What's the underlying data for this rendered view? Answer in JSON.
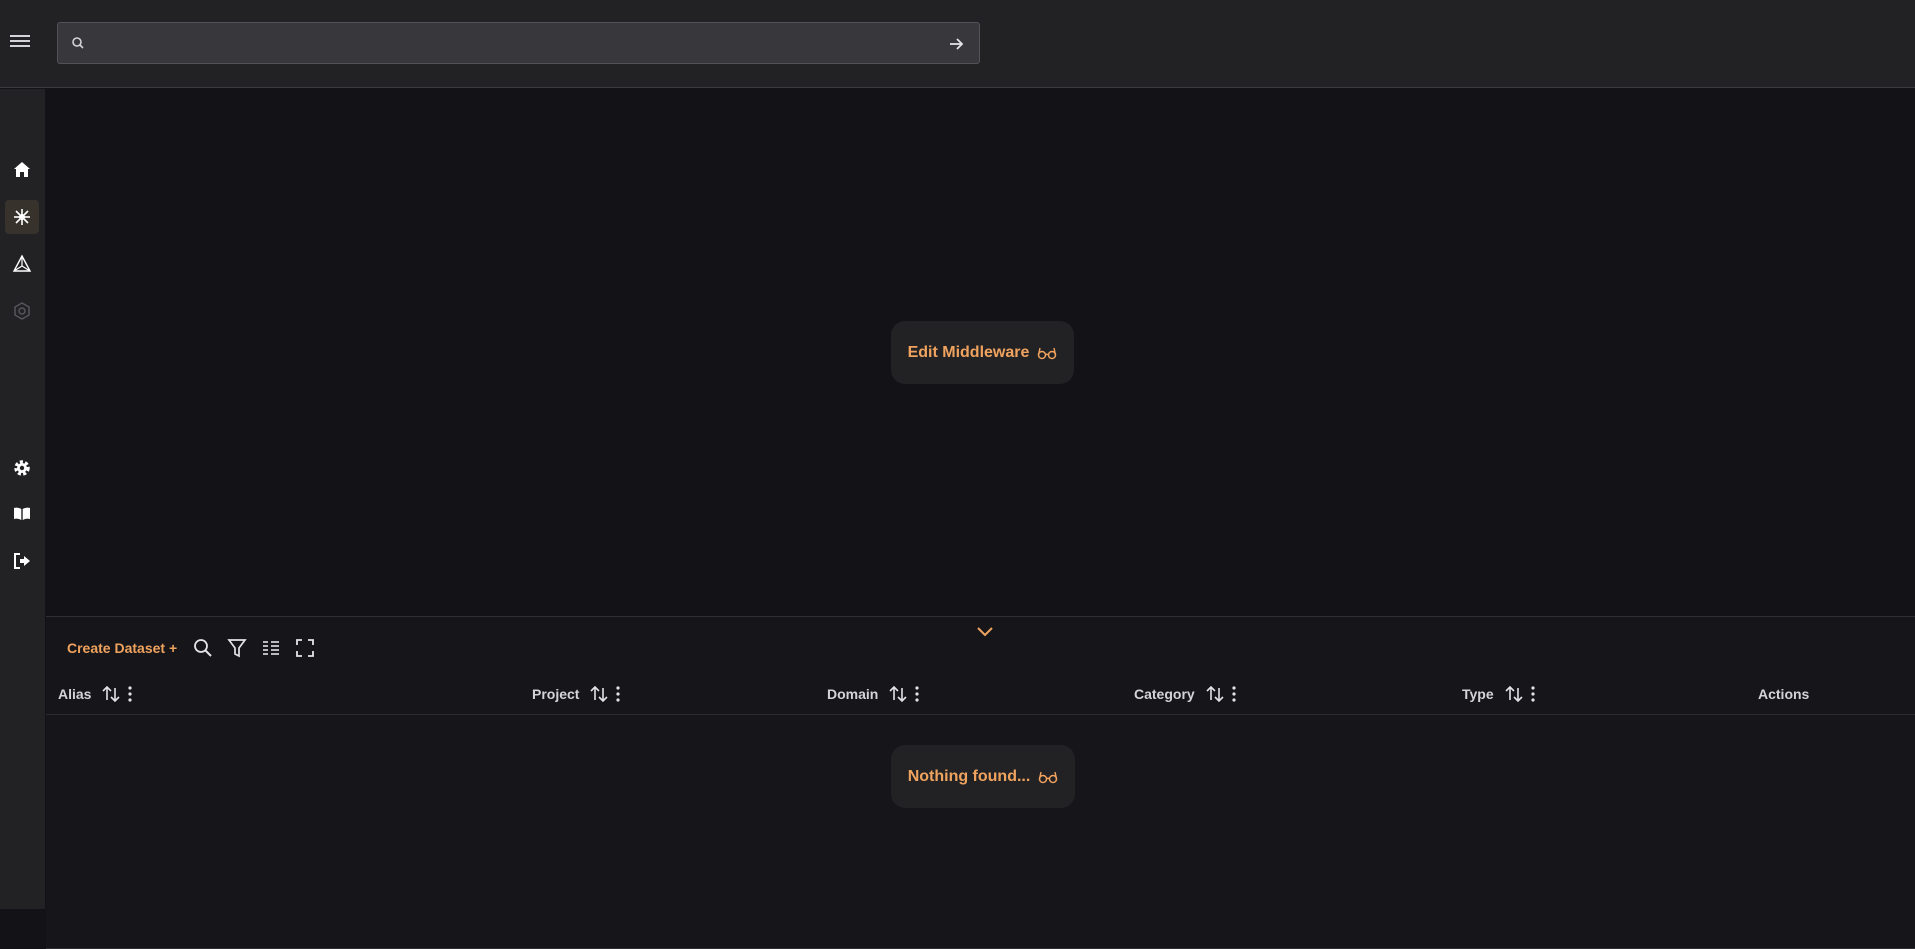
{
  "search": {
    "value": "",
    "placeholder": ""
  },
  "sidebar": {
    "items": [
      {
        "name": "home",
        "icon": "home-icon",
        "active": false
      },
      {
        "name": "middleware",
        "icon": "sparkle-icon",
        "active": true
      },
      {
        "name": "graph",
        "icon": "triangle-network-icon",
        "active": false
      },
      {
        "name": "settings-disabled",
        "icon": "hex-gear-icon",
        "active": false
      },
      {
        "name": "settings",
        "icon": "gear-icon",
        "active": false
      },
      {
        "name": "docs",
        "icon": "book-icon",
        "active": false
      },
      {
        "name": "logout",
        "icon": "logout-icon",
        "active": false
      }
    ]
  },
  "main": {
    "edit_label": "Edit Middleware"
  },
  "panel": {
    "create_label": "Create Dataset +",
    "columns": [
      {
        "label": "Alias"
      },
      {
        "label": "Project"
      },
      {
        "label": "Domain"
      },
      {
        "label": "Category"
      },
      {
        "label": "Type"
      },
      {
        "label": "Actions"
      }
    ],
    "empty_label": "Nothing found..."
  },
  "colors": {
    "accent": "#f0a35e",
    "background": "#131317",
    "surface": "#222225"
  }
}
